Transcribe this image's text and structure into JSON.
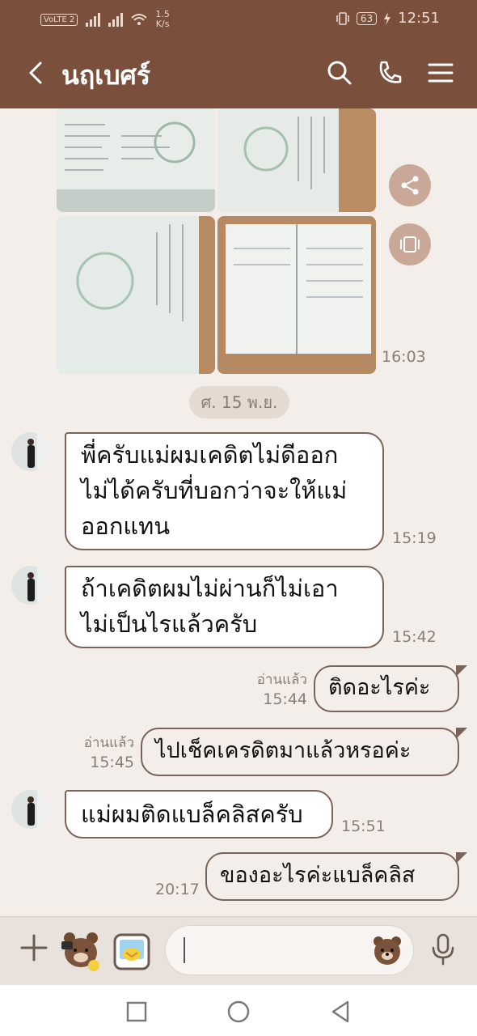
{
  "status_bar": {
    "volte": "VoLTE 2",
    "speed_value": "1.5",
    "speed_unit": "K/s",
    "battery": "63",
    "clock": "12:51"
  },
  "header": {
    "title": "นฤเบศร์"
  },
  "messages": {
    "photo_time": "16:03",
    "date_divider": "ศ. 15 พ.ย.",
    "m1": {
      "line1": "พี่ครับแม่ผมเคดิตไม่ดีออก",
      "line2": "ไม่ได้ครับที่บอกว่าจะให้แม่",
      "line3": "ออกแทน",
      "time": "15:19"
    },
    "m2": {
      "line1": "ถ้าเคดิตผมไม่ผ่านก็ไม่เอา",
      "line2": "ไม่เป็นไรแล้วครับ",
      "time": "15:42"
    },
    "m3": {
      "text": "ติดอะไรค่ะ",
      "read": "อ่านแล้ว",
      "time": "15:44"
    },
    "m4": {
      "text": "ไปเช็คเครดิตมาแล้วหรอค่ะ",
      "read": "อ่านแล้ว",
      "time": "15:45"
    },
    "m5": {
      "text": "แม่ผมติดแบล็คลิสครับ",
      "time": "15:51"
    },
    "m6": {
      "text": "ของอะไรค่ะแบล็คลิส",
      "time": "20:17"
    }
  },
  "colors": {
    "header_brown": "#7a4f3c",
    "chat_bg": "#f3eee9",
    "bubble_border": "#7a6358",
    "side_button": "#c9a898"
  },
  "icons": {
    "header": [
      "back-arrow-icon",
      "search-icon",
      "phone-icon",
      "menu-icon"
    ],
    "composer": [
      "plus-icon",
      "bear-sticker-icon",
      "sticker-icon",
      "bear-emoji-icon",
      "mic-icon"
    ],
    "nav": [
      "recent-apps-icon",
      "home-icon",
      "back-triangle-icon"
    ]
  }
}
